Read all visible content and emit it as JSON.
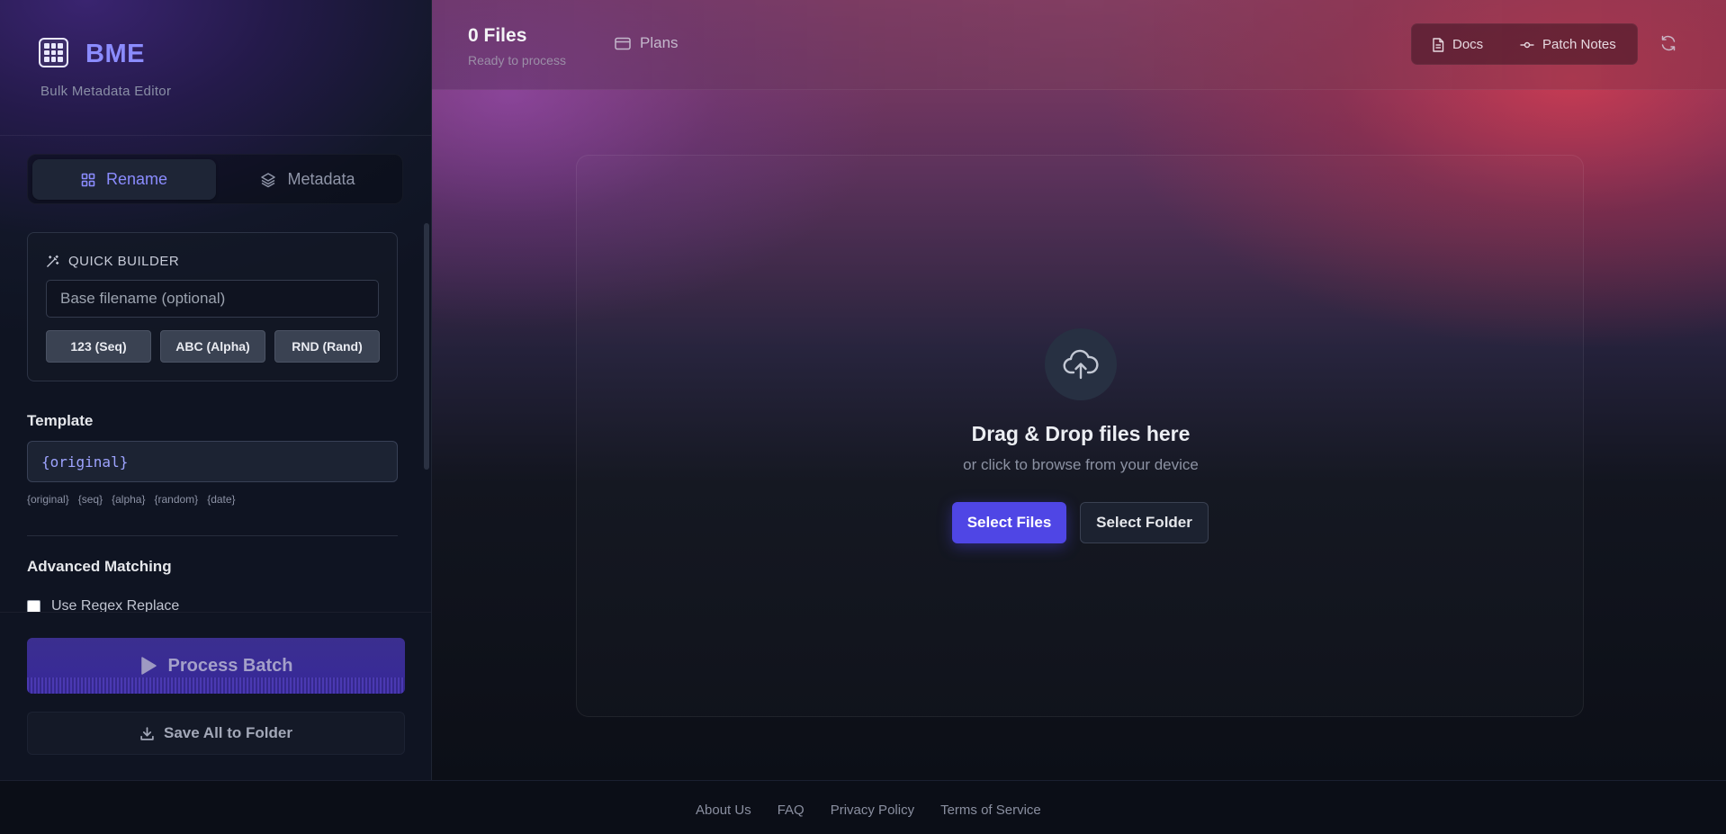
{
  "brand": {
    "name": "BME",
    "subtitle": "Bulk Metadata Editor"
  },
  "mode_toggle": {
    "rename_label": "Rename",
    "metadata_label": "Metadata",
    "active": "Rename"
  },
  "quick_builder": {
    "title": "QUICK BUILDER",
    "input_placeholder": "Base filename (optional)",
    "input_value": "",
    "buttons": [
      "123 (Seq)",
      "ABC (Alpha)",
      "RND (Rand)"
    ]
  },
  "template": {
    "label": "Template",
    "value": "{original}",
    "tokens": [
      "{original}",
      "{seq}",
      "{alpha}",
      "{random}",
      "{date}"
    ]
  },
  "advanced": {
    "label": "Advanced Matching",
    "regex_label": "Use Regex Replace",
    "regex_checked": false
  },
  "actions": {
    "process_label": "Process Batch",
    "save_label": "Save All to Folder"
  },
  "header": {
    "files_count": "0 Files",
    "status": "Ready to process",
    "plans_label": "Plans",
    "docs_label": "Docs",
    "patch_notes_label": "Patch Notes"
  },
  "dropzone": {
    "title": "Drag & Drop files here",
    "subtitle": "or click to browse from your device",
    "select_files_label": "Select Files",
    "select_folder_label": "Select Folder"
  },
  "footer": {
    "links": [
      "About Us",
      "FAQ",
      "Privacy Policy",
      "Terms of Service"
    ]
  },
  "colors": {
    "accent": "#4f46e5",
    "brand": "#8b8cff",
    "sidebar_bg": "#121728",
    "main_bg": "#0c0f17"
  },
  "icons": {
    "logo": "grid-icon",
    "rename": "grid-icon",
    "metadata": "layers-icon",
    "quick_builder": "magic-wand-icon",
    "process": "play-icon",
    "save": "download-icon",
    "plans": "credit-card-icon",
    "docs": "file-icon",
    "patch_notes": "commit-icon",
    "refresh": "refresh-icon",
    "upload": "cloud-upload-icon"
  }
}
